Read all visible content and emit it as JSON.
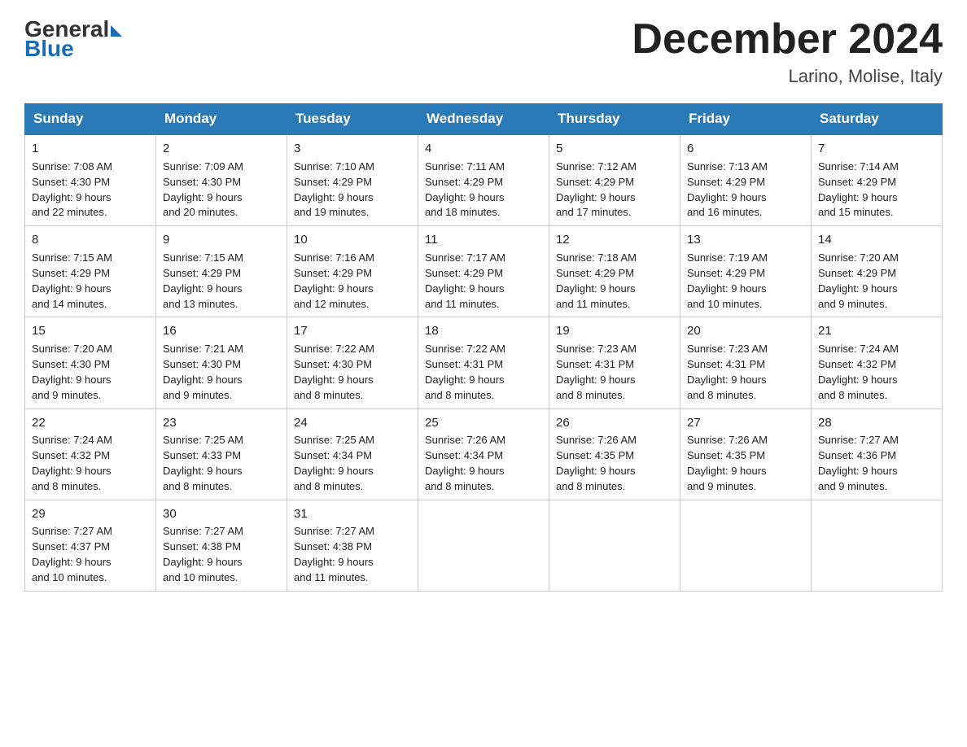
{
  "logo": {
    "general": "General",
    "blue": "Blue"
  },
  "title": "December 2024",
  "location": "Larino, Molise, Italy",
  "days_of_week": [
    "Sunday",
    "Monday",
    "Tuesday",
    "Wednesday",
    "Thursday",
    "Friday",
    "Saturday"
  ],
  "weeks": [
    [
      {
        "day": "1",
        "sunrise": "7:08 AM",
        "sunset": "4:30 PM",
        "daylight": "9 hours and 22 minutes."
      },
      {
        "day": "2",
        "sunrise": "7:09 AM",
        "sunset": "4:30 PM",
        "daylight": "9 hours and 20 minutes."
      },
      {
        "day": "3",
        "sunrise": "7:10 AM",
        "sunset": "4:29 PM",
        "daylight": "9 hours and 19 minutes."
      },
      {
        "day": "4",
        "sunrise": "7:11 AM",
        "sunset": "4:29 PM",
        "daylight": "9 hours and 18 minutes."
      },
      {
        "day": "5",
        "sunrise": "7:12 AM",
        "sunset": "4:29 PM",
        "daylight": "9 hours and 17 minutes."
      },
      {
        "day": "6",
        "sunrise": "7:13 AM",
        "sunset": "4:29 PM",
        "daylight": "9 hours and 16 minutes."
      },
      {
        "day": "7",
        "sunrise": "7:14 AM",
        "sunset": "4:29 PM",
        "daylight": "9 hours and 15 minutes."
      }
    ],
    [
      {
        "day": "8",
        "sunrise": "7:15 AM",
        "sunset": "4:29 PM",
        "daylight": "9 hours and 14 minutes."
      },
      {
        "day": "9",
        "sunrise": "7:15 AM",
        "sunset": "4:29 PM",
        "daylight": "9 hours and 13 minutes."
      },
      {
        "day": "10",
        "sunrise": "7:16 AM",
        "sunset": "4:29 PM",
        "daylight": "9 hours and 12 minutes."
      },
      {
        "day": "11",
        "sunrise": "7:17 AM",
        "sunset": "4:29 PM",
        "daylight": "9 hours and 11 minutes."
      },
      {
        "day": "12",
        "sunrise": "7:18 AM",
        "sunset": "4:29 PM",
        "daylight": "9 hours and 11 minutes."
      },
      {
        "day": "13",
        "sunrise": "7:19 AM",
        "sunset": "4:29 PM",
        "daylight": "9 hours and 10 minutes."
      },
      {
        "day": "14",
        "sunrise": "7:20 AM",
        "sunset": "4:29 PM",
        "daylight": "9 hours and 9 minutes."
      }
    ],
    [
      {
        "day": "15",
        "sunrise": "7:20 AM",
        "sunset": "4:30 PM",
        "daylight": "9 hours and 9 minutes."
      },
      {
        "day": "16",
        "sunrise": "7:21 AM",
        "sunset": "4:30 PM",
        "daylight": "9 hours and 9 minutes."
      },
      {
        "day": "17",
        "sunrise": "7:22 AM",
        "sunset": "4:30 PM",
        "daylight": "9 hours and 8 minutes."
      },
      {
        "day": "18",
        "sunrise": "7:22 AM",
        "sunset": "4:31 PM",
        "daylight": "9 hours and 8 minutes."
      },
      {
        "day": "19",
        "sunrise": "7:23 AM",
        "sunset": "4:31 PM",
        "daylight": "9 hours and 8 minutes."
      },
      {
        "day": "20",
        "sunrise": "7:23 AM",
        "sunset": "4:31 PM",
        "daylight": "9 hours and 8 minutes."
      },
      {
        "day": "21",
        "sunrise": "7:24 AM",
        "sunset": "4:32 PM",
        "daylight": "9 hours and 8 minutes."
      }
    ],
    [
      {
        "day": "22",
        "sunrise": "7:24 AM",
        "sunset": "4:32 PM",
        "daylight": "9 hours and 8 minutes."
      },
      {
        "day": "23",
        "sunrise": "7:25 AM",
        "sunset": "4:33 PM",
        "daylight": "9 hours and 8 minutes."
      },
      {
        "day": "24",
        "sunrise": "7:25 AM",
        "sunset": "4:34 PM",
        "daylight": "9 hours and 8 minutes."
      },
      {
        "day": "25",
        "sunrise": "7:26 AM",
        "sunset": "4:34 PM",
        "daylight": "9 hours and 8 minutes."
      },
      {
        "day": "26",
        "sunrise": "7:26 AM",
        "sunset": "4:35 PM",
        "daylight": "9 hours and 8 minutes."
      },
      {
        "day": "27",
        "sunrise": "7:26 AM",
        "sunset": "4:35 PM",
        "daylight": "9 hours and 9 minutes."
      },
      {
        "day": "28",
        "sunrise": "7:27 AM",
        "sunset": "4:36 PM",
        "daylight": "9 hours and 9 minutes."
      }
    ],
    [
      {
        "day": "29",
        "sunrise": "7:27 AM",
        "sunset": "4:37 PM",
        "daylight": "9 hours and 10 minutes."
      },
      {
        "day": "30",
        "sunrise": "7:27 AM",
        "sunset": "4:38 PM",
        "daylight": "9 hours and 10 minutes."
      },
      {
        "day": "31",
        "sunrise": "7:27 AM",
        "sunset": "4:38 PM",
        "daylight": "9 hours and 11 minutes."
      },
      null,
      null,
      null,
      null
    ]
  ],
  "labels": {
    "sunrise": "Sunrise:",
    "sunset": "Sunset:",
    "daylight": "Daylight:"
  }
}
